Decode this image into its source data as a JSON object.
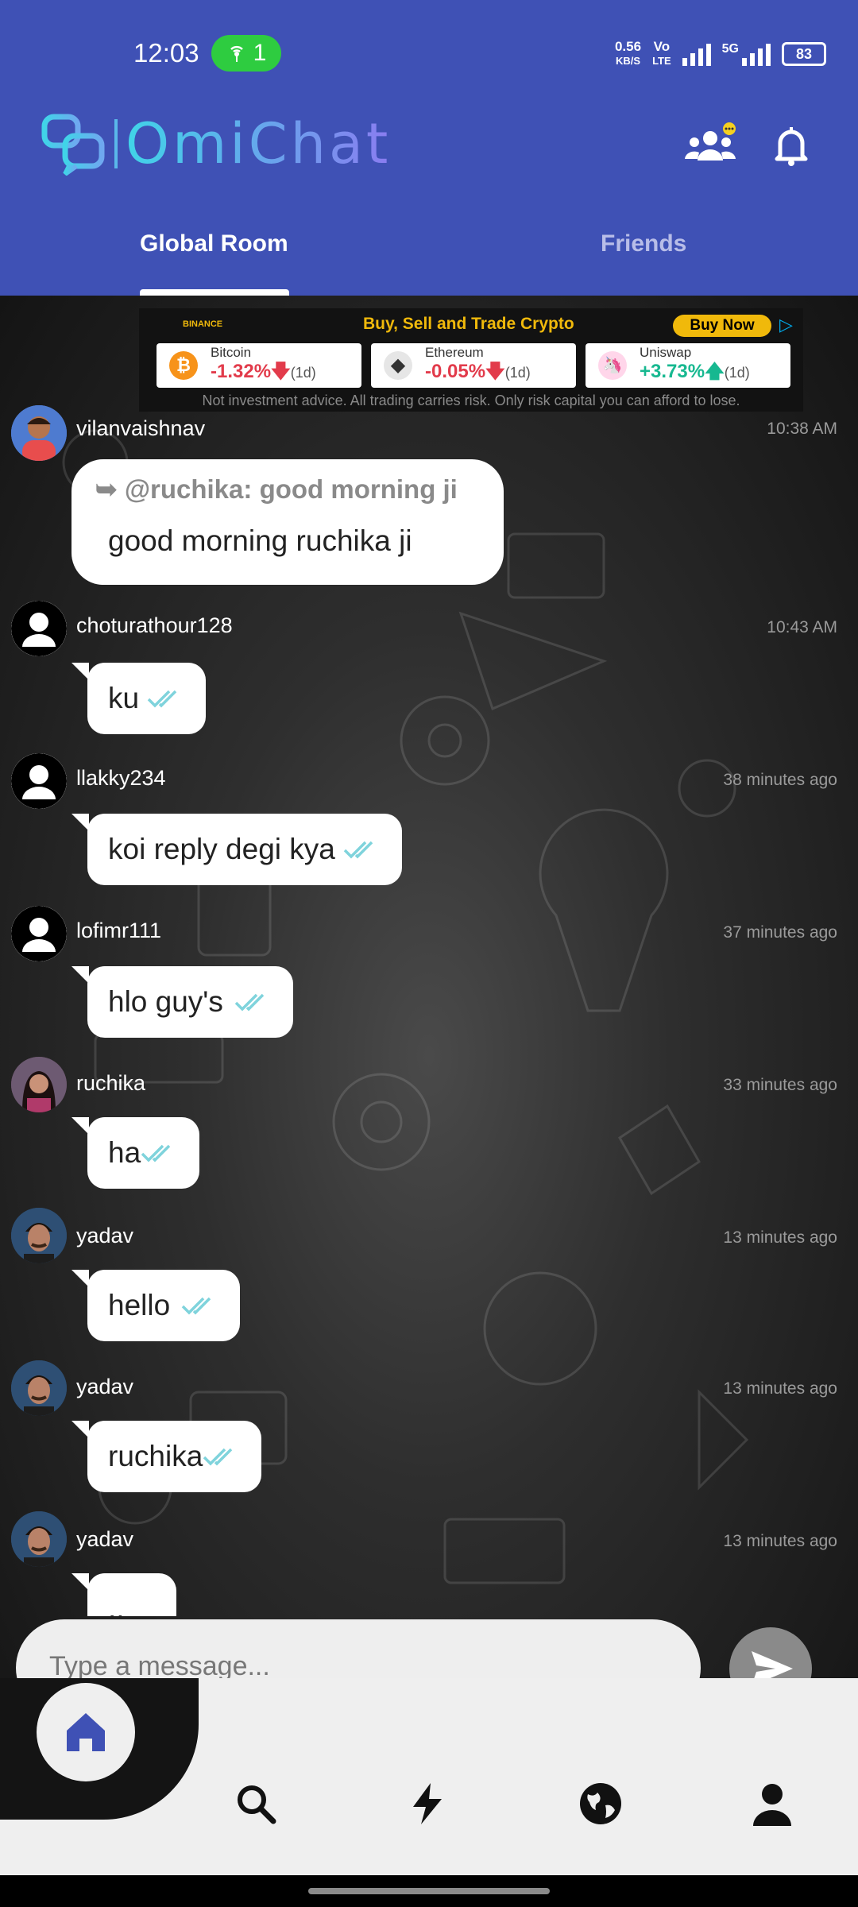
{
  "status_bar": {
    "time": "12:03",
    "hotspot_count": "1",
    "speed_value": "0.56",
    "speed_unit": "KB/S",
    "volte_top": "Vo",
    "volte_bottom": "LTE",
    "network": "5G",
    "battery": "83"
  },
  "app": {
    "logo_text": "OmiChat",
    "tabs": [
      {
        "label": "Global Room",
        "active": true
      },
      {
        "label": "Friends",
        "active": false
      }
    ]
  },
  "ad": {
    "brand": "BINANCE",
    "title": "Buy, Sell and Trade Crypto",
    "cta": "Buy Now",
    "coins": [
      {
        "name": "Bitcoin",
        "change": "-1.32%",
        "period": "(1d)",
        "direction": "down",
        "color": "#f7931a"
      },
      {
        "name": "Ethereum",
        "change": "-0.05%",
        "period": "(1d)",
        "direction": "down",
        "color": "#627eea"
      },
      {
        "name": "Uniswap",
        "change": "+3.73%",
        "period": "(1d)",
        "direction": "up",
        "color": "#ff007a"
      }
    ],
    "disclaimer": "Not investment advice. All trading carries risk. Only risk capital you can afford to lose."
  },
  "messages": [
    {
      "user": "vilanvaishnav",
      "time": "10:38 AM",
      "reply_to": "@ruchika:",
      "reply_text": "good morning ji",
      "text": "good morning ruchika ji"
    },
    {
      "user": "choturathour128",
      "time": "10:43 AM",
      "text": "ku"
    },
    {
      "user": "llakky234",
      "time": "38 minutes ago",
      "text": "koi reply degi kya"
    },
    {
      "user": "lofimr111",
      "time": "37 minutes ago",
      "text": "hlo guy's"
    },
    {
      "user": "ruchika",
      "time": "33 minutes ago",
      "text": "ha"
    },
    {
      "user": "yadav",
      "time": "13 minutes ago",
      "text": "hello"
    },
    {
      "user": "yadav",
      "time": "13 minutes ago",
      "text": "ruchika"
    },
    {
      "user": "yadav",
      "time": "13 minutes ago",
      "text": ".."
    }
  ],
  "composer": {
    "placeholder": "Type a message..."
  },
  "colors": {
    "primary": "#3f51b5",
    "tick": "#7fd3dc",
    "up": "#17b890",
    "down": "#e23b4b"
  },
  "icons": {
    "header": [
      "friends-icon",
      "bell-icon"
    ],
    "nav": [
      "home-icon",
      "search-icon",
      "flash-icon",
      "globe-icon",
      "profile-icon"
    ]
  }
}
